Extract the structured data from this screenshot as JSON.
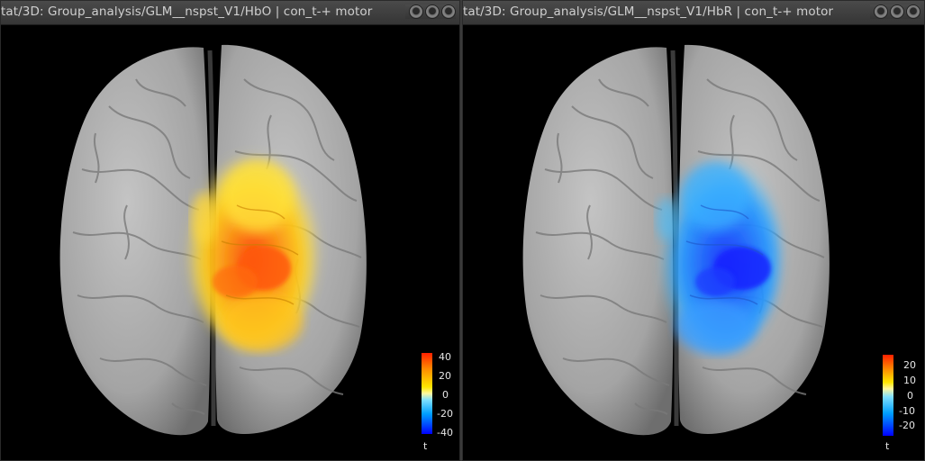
{
  "windows": [
    {
      "title": "tat/3D: Group_analysis/GLM__nspst_V1/HbO | con_t-+ motor",
      "colorbar": {
        "ticks": [
          "40",
          "20",
          "0",
          "-20",
          "-40"
        ],
        "label": "t"
      },
      "activation": "positive"
    },
    {
      "title": "tat/3D: Group_analysis/GLM__nspst_V1/HbR | con_t-+ motor",
      "colorbar": {
        "ticks": [
          "20",
          "10",
          "0",
          "-10",
          "-20"
        ],
        "label": "t"
      },
      "activation": "negative"
    }
  ],
  "colors": {
    "background": "#000000",
    "cortex": "#a8a8a8",
    "hbo_activation": "#ffb000",
    "hbr_activation": "#2a7cff"
  }
}
